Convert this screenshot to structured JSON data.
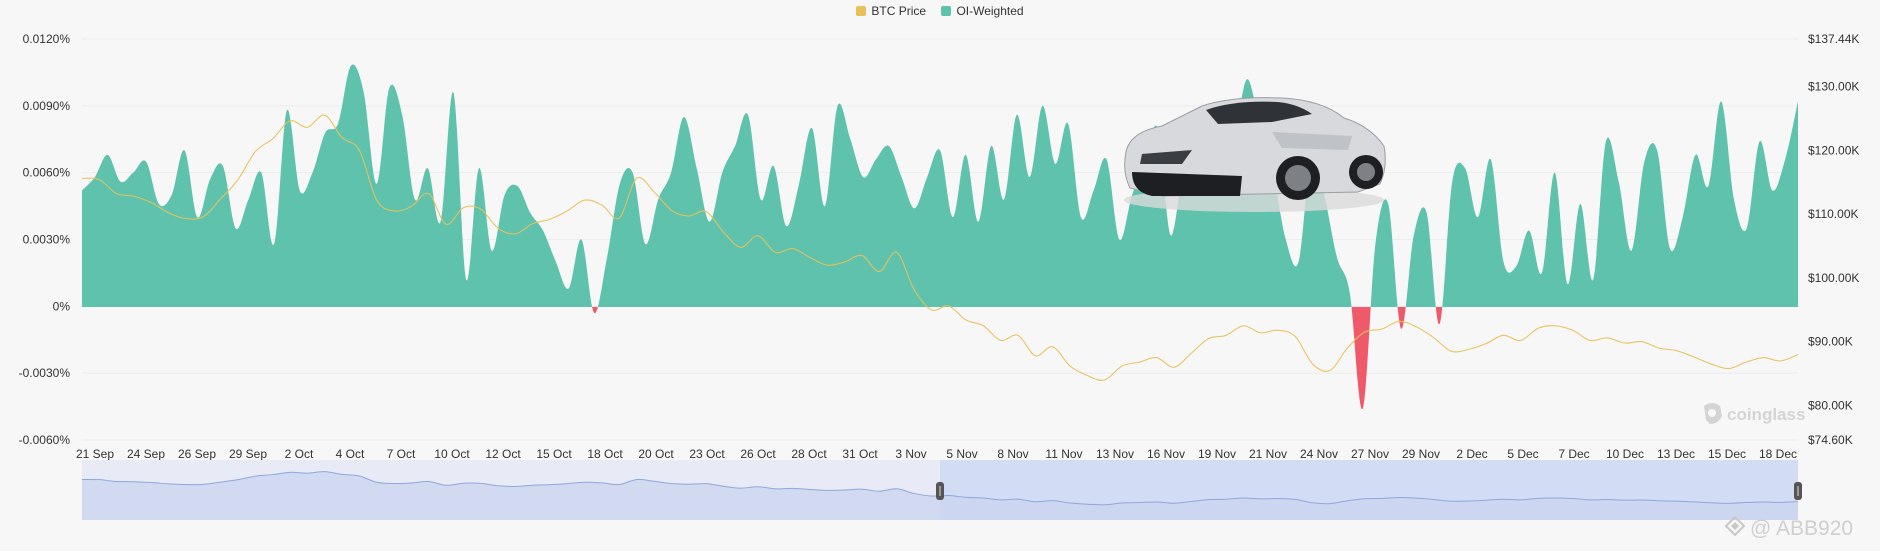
{
  "chart_data": {
    "type": "area",
    "legend": [
      {
        "name": "BTC Price",
        "color": "#e8c15c"
      },
      {
        "name": "OI-Weighted",
        "color": "#5ec2ad"
      }
    ],
    "negative_color": "#ee5a6a",
    "left_axis": {
      "ticks": [
        "0.0120%",
        "0.0090%",
        "0.0060%",
        "0.0030%",
        "0%",
        "-0.0030%",
        "-0.0060%"
      ],
      "tick_values": [
        0.012,
        0.009,
        0.006,
        0.003,
        0,
        -0.003,
        -0.006
      ],
      "range": [
        -0.006,
        0.012
      ]
    },
    "right_axis": {
      "ticks": [
        "$137.44K",
        "$130.00K",
        "$120.00K",
        "$110.00K",
        "$100.00K",
        "$90.00K",
        "$80.00K",
        "$74.60K"
      ],
      "tick_values": [
        137.44,
        130,
        120,
        110,
        100,
        90,
        80,
        74.6
      ],
      "range": [
        74.6,
        137.44
      ]
    },
    "x_ticks": [
      "21 Sep",
      "24 Sep",
      "26 Sep",
      "29 Sep",
      "2 Oct",
      "4 Oct",
      "7 Oct",
      "10 Oct",
      "12 Oct",
      "15 Oct",
      "18 Oct",
      "20 Oct",
      "23 Oct",
      "26 Oct",
      "28 Oct",
      "31 Oct",
      "3 Nov",
      "5 Nov",
      "8 Nov",
      "11 Nov",
      "13 Nov",
      "16 Nov",
      "19 Nov",
      "21 Nov",
      "24 Nov",
      "27 Nov",
      "29 Nov",
      "2 Dec",
      "5 Dec",
      "7 Dec",
      "10 Dec",
      "13 Dec",
      "15 Dec",
      "18 Dec"
    ],
    "series": [
      {
        "name": "OI-Weighted",
        "unit": "%",
        "values": [
          0.0052,
          0.0058,
          0.0068,
          0.0056,
          0.006,
          0.0065,
          0.0046,
          0.005,
          0.007,
          0.004,
          0.0057,
          0.0063,
          0.0035,
          0.0048,
          0.006,
          0.0028,
          0.0088,
          0.0052,
          0.006,
          0.0078,
          0.0082,
          0.0108,
          0.0096,
          0.0055,
          0.0098,
          0.0086,
          0.0048,
          0.0062,
          0.0038,
          0.0096,
          0.0012,
          0.0062,
          0.0025,
          0.005,
          0.0054,
          0.0042,
          0.0034,
          0.002,
          0.0008,
          0.003,
          -0.0003,
          0.0022,
          0.0055,
          0.006,
          0.0028,
          0.0048,
          0.006,
          0.0085,
          0.0062,
          0.0038,
          0.006,
          0.0072,
          0.0086,
          0.0048,
          0.0063,
          0.0036,
          0.0055,
          0.008,
          0.0045,
          0.009,
          0.0075,
          0.0058,
          0.0066,
          0.0072,
          0.0058,
          0.0044,
          0.0058,
          0.007,
          0.004,
          0.0068,
          0.0038,
          0.0072,
          0.0048,
          0.0086,
          0.0058,
          0.009,
          0.0064,
          0.0082,
          0.004,
          0.0052,
          0.0066,
          0.003,
          0.005,
          0.0065,
          0.008,
          0.0032,
          0.0062,
          0.0078,
          0.005,
          0.0088,
          0.008,
          0.0102,
          0.008,
          0.006,
          0.003,
          0.002,
          0.0068,
          0.005,
          0.0022,
          0.0006,
          -0.0046,
          0.0028,
          0.0046,
          -0.001,
          0.0032,
          0.0042,
          -0.0008,
          0.0056,
          0.0062,
          0.004,
          0.0066,
          0.002,
          0.0018,
          0.0034,
          0.0015,
          0.006,
          0.001,
          0.0046,
          0.0012,
          0.0074,
          0.0056,
          0.0025,
          0.0065,
          0.007,
          0.0026,
          0.004,
          0.0068,
          0.0054,
          0.0092,
          0.0048,
          0.0035,
          0.0074,
          0.0052,
          0.0066,
          0.0092
        ]
      },
      {
        "name": "BTC Price",
        "unit": "USD thousands",
        "values": [
          115.6,
          115.4,
          113.2,
          112.8,
          111.8,
          110.2,
          109.3,
          109.6,
          112.4,
          115.4,
          119.8,
          121.8,
          124.6,
          123.6,
          125.5,
          122.0,
          120.0,
          112.2,
          110.5,
          111.2,
          113.2,
          108.4,
          111.0,
          110.8,
          107.8,
          106.9,
          108.5,
          109.2,
          110.5,
          112.2,
          111.4,
          109.4,
          115.6,
          113.5,
          110.6,
          109.7,
          110.4,
          107.2,
          104.8,
          106.6,
          104.0,
          104.6,
          103.2,
          102.0,
          102.5,
          103.5,
          101.0,
          104.0,
          98.2,
          95.0,
          95.6,
          93.4,
          92.5,
          90.2,
          91.0,
          87.8,
          89.2,
          86.2,
          84.7,
          84.0,
          86.2,
          86.8,
          87.5,
          86.0,
          88.2,
          90.5,
          91.0,
          92.5,
          91.4,
          91.8,
          90.8,
          86.5,
          85.5,
          89.0,
          91.5,
          92.0,
          93.2,
          92.3,
          90.6,
          88.5,
          88.8,
          89.7,
          91.0,
          90.2,
          92.1,
          92.5,
          91.8,
          90.2,
          90.6,
          89.8,
          90.0,
          89.0,
          88.6,
          87.6,
          86.5,
          85.8,
          86.8,
          87.5,
          87.0,
          88.0
        ]
      }
    ]
  },
  "navigator": {
    "selected_start": 0.5,
    "selected_end": 1.0
  },
  "watermarks": {
    "brand": "coinglass",
    "handle": "@ ABB920"
  },
  "colors": {
    "green": "#5ec2ad",
    "gold": "#e8c15c",
    "red": "#ee5a6a",
    "nav_line": "#8fa6df",
    "nav_fill": "#dde4f7"
  }
}
